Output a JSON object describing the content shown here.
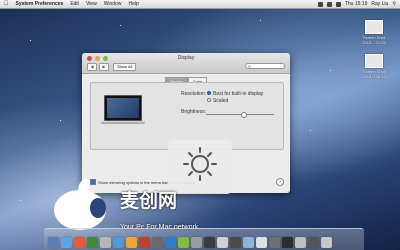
{
  "menubar": {
    "apple": "",
    "app_name": "System Preferences",
    "menus": [
      "Edit",
      "View",
      "Window",
      "Help"
    ],
    "clock": "Thu 15:19",
    "user": "Ray Liu"
  },
  "desktop_files": [
    {
      "name": "Screen Shot",
      "date": "2013....21.05"
    },
    {
      "name": "Screen Shot",
      "date": "2013....38.13"
    }
  ],
  "window": {
    "title": "Display",
    "show_all": "Show All",
    "tabs": [
      "Display",
      "Color"
    ],
    "selected_tab": "Display",
    "resolution_label": "Resolution:",
    "resolution_options": [
      "Best for built-in display",
      "Scaled"
    ],
    "resolution_selected": "Best for built-in display",
    "brightness_label": "Brightness:",
    "brightness_value": 0.55,
    "mirroring_label": "Show mirroring options in the menu bar when available",
    "mirroring_checked": true,
    "help": "?"
  },
  "hud": {
    "icon": "brightness-icon",
    "level": 0.55
  },
  "watermark": {
    "chinese": "麦创网",
    "tagline": "Your Pc For Mac network"
  },
  "dock": {
    "colors": [
      "#5b7fb3",
      "#5aa3e6",
      "#e65b3c",
      "#3d8c3a",
      "#b7b7b7",
      "#4e9ad6",
      "#f1a33a",
      "#c33f2f",
      "#6b6b6b",
      "#2f7dd1",
      "#7fbf3d",
      "#9d9d9d",
      "#3b3b3b",
      "#d1d1d1",
      "#4a4a4a",
      "#8fb4d6",
      "#e0e0e0",
      "#6f6f6f",
      "#2d2d2d",
      "#bfbfbf",
      "#555555",
      "#c8c8c8"
    ]
  }
}
